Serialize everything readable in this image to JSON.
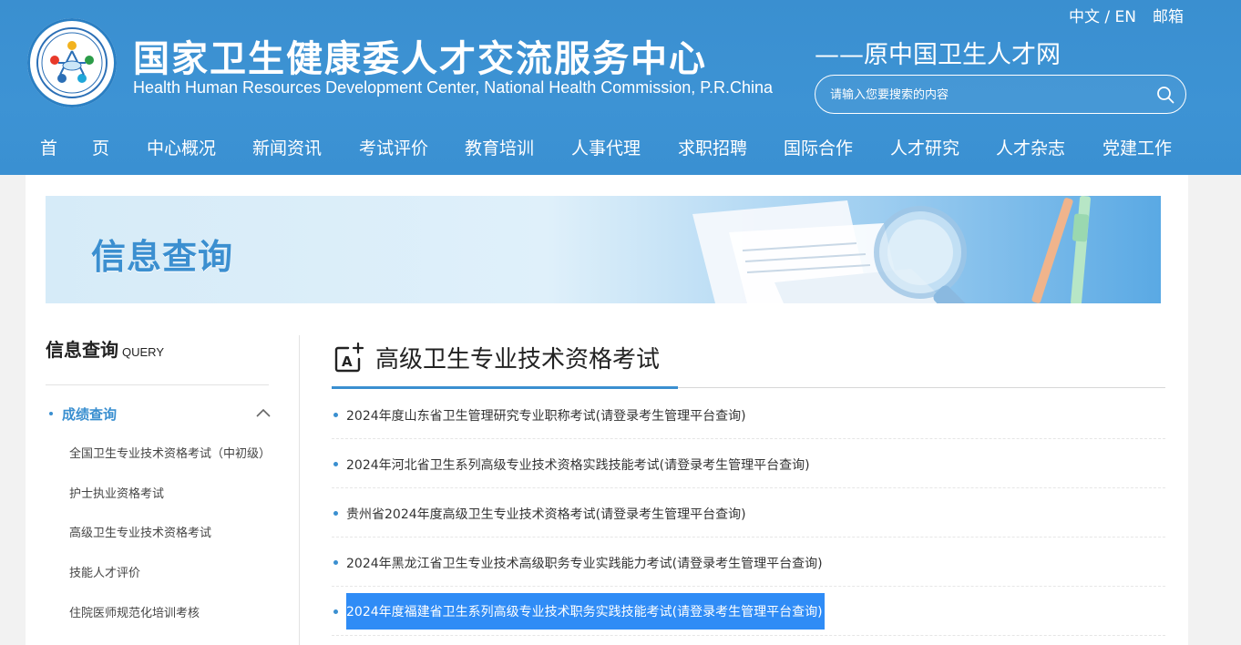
{
  "header": {
    "site_name_cn": "国家卫生健康委人才交流服务中心",
    "site_name_en": "Health Human Resources Development Center, National Health Commission, P.R.China",
    "slogan": "——原中国卫生人才网",
    "lang_switch": "中文 / EN",
    "mail_label": "邮箱",
    "search": {
      "placeholder": "请输入您要搜索的内容"
    },
    "nav": [
      "首　　页",
      "中心概况",
      "新闻资讯",
      "考试评价",
      "教育培训",
      "人事代理",
      "求职招聘",
      "国际合作",
      "人才研究",
      "人才杂志",
      "党建工作"
    ]
  },
  "banner": {
    "title": "信息查询"
  },
  "sidebar": {
    "title_cn": "信息查询",
    "title_en": "QUERY",
    "group_label": "成绩查询",
    "items": [
      "全国卫生专业技术资格考试（中初级）",
      "护士执业资格考试",
      "高级卫生专业技术资格考试",
      "技能人才评价",
      "住院医师规范化培训考核"
    ]
  },
  "main": {
    "title": "高级卫生专业技术资格考试",
    "items": [
      "2024年度山东省卫生管理研究专业职称考试(请登录考生管理平台查询)",
      "2024年河北省卫生系列高级专业技术资格实践技能考试(请登录考生管理平台查询)",
      "贵州省2024年度高级卫生专业技术资格考试(请登录考生管理平台查询)",
      "2024年黑龙江省卫生专业技术高级职务专业实践能力考试(请登录考生管理平台查询)",
      "2024年度福建省卫生系列高级专业技术职务实践技能考试(请登录考生管理平台查询)"
    ],
    "active_index": 4
  },
  "colors": {
    "brand_blue": "#3a8fd0",
    "highlight": "#2f8cf6"
  }
}
